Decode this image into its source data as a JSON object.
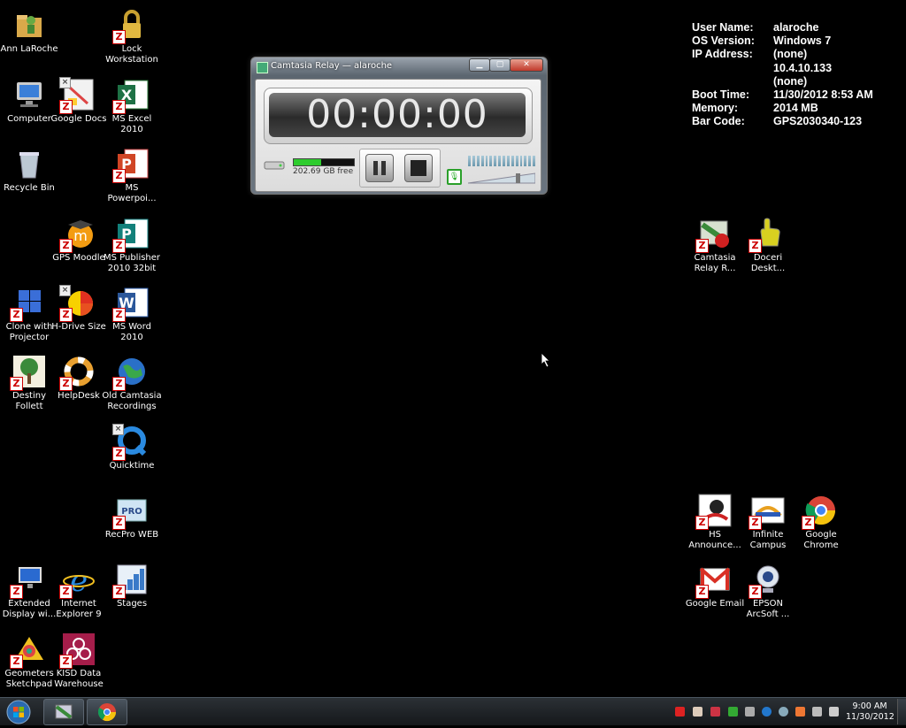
{
  "desktop_icons": [
    {
      "label": "Ann LaRoche",
      "icon": "user-folder-icon",
      "badge": false
    },
    {
      "label": "Lock Workstation",
      "icon": "padlock-icon",
      "badge": true
    },
    {
      "label": "Computer",
      "icon": "computer-icon",
      "badge": false
    },
    {
      "label": "Google Docs",
      "icon": "google-docs-icon",
      "badge": true
    },
    {
      "label": "MS Excel 2010",
      "icon": "excel-icon",
      "badge": true
    },
    {
      "label": "Recycle Bin",
      "icon": "recycle-bin-icon",
      "badge": false
    },
    {
      "label": "MS Powerpoi...",
      "icon": "powerpoint-icon",
      "badge": true
    },
    {
      "label": "GPS Moodle",
      "icon": "moodle-icon",
      "badge": true
    },
    {
      "label": "MS Publisher 2010 32bit",
      "icon": "publisher-icon",
      "badge": true
    },
    {
      "label": "Clone with Projector",
      "icon": "windows-clone-icon",
      "badge": true
    },
    {
      "label": "H-Drive Size",
      "icon": "pie-chart-icon",
      "badge": true
    },
    {
      "label": "MS Word 2010",
      "icon": "word-icon",
      "badge": true
    },
    {
      "label": "Destiny Follett",
      "icon": "tree-icon",
      "badge": true
    },
    {
      "label": "HelpDesk",
      "icon": "lifebuoy-icon",
      "badge": true
    },
    {
      "label": "Old Camtasia Recordings",
      "icon": "globe-icon",
      "badge": true
    },
    {
      "label": "Quicktime",
      "icon": "quicktime-icon",
      "badge": true
    },
    {
      "label": "RecPro WEB",
      "icon": "recpro-icon",
      "badge": true
    },
    {
      "label": "Extended Display wi...",
      "icon": "display-icon",
      "badge": true
    },
    {
      "label": "Internet Explorer 9",
      "icon": "ie-icon",
      "badge": true
    },
    {
      "label": "Stages",
      "icon": "stages-icon",
      "badge": true
    },
    {
      "label": "Geometers Sketchpad",
      "icon": "sketchpad-icon",
      "badge": true
    },
    {
      "label": "KISD Data Warehouse",
      "icon": "warehouse-logo-icon",
      "badge": true
    },
    {
      "label": "Camtasia Relay R...",
      "icon": "camtasia-record-icon",
      "badge": true
    },
    {
      "label": "Doceri Deskt...",
      "icon": "doceri-hand-icon",
      "badge": true
    },
    {
      "label": "HS Announce...",
      "icon": "announce-logo-icon",
      "badge": true
    },
    {
      "label": "Infinite Campus",
      "icon": "campus-icon",
      "badge": true
    },
    {
      "label": "Google Chrome",
      "icon": "chrome-icon",
      "badge": true
    },
    {
      "label": "Google Email",
      "icon": "gmail-icon",
      "badge": true
    },
    {
      "label": "EPSON ArcSoft ...",
      "icon": "webcam-icon",
      "badge": true
    }
  ],
  "sysinfo": {
    "user_label": "User Name:",
    "user_value": "alaroche",
    "os_label": "OS Version:",
    "os_value": "Windows 7",
    "ip_label": "IP Address:",
    "ip_value1": "(none)",
    "ip_value2": "10.4.10.133",
    "ip_value3": "(none)",
    "boot_label": "Boot Time:",
    "boot_value": "11/30/2012 8:53 AM",
    "mem_label": "Memory:",
    "mem_value": "2014 MB",
    "bar_label": "Bar Code:",
    "bar_value": "GPS2030340-123"
  },
  "relay_window": {
    "title": "Camtasia Relay — alaroche",
    "timer": "00:00:00",
    "disk_free": "202.69 GB free",
    "disk_fill_fraction": 0.45,
    "mic_glyph": "🎙"
  },
  "taskbar": {
    "clock_time": "9:00 AM",
    "clock_date": "11/30/2012"
  },
  "colors": {
    "desktop_bg": "#000000",
    "disk_fill": "#2ecc2e",
    "mic_border": "#2aa02a"
  }
}
